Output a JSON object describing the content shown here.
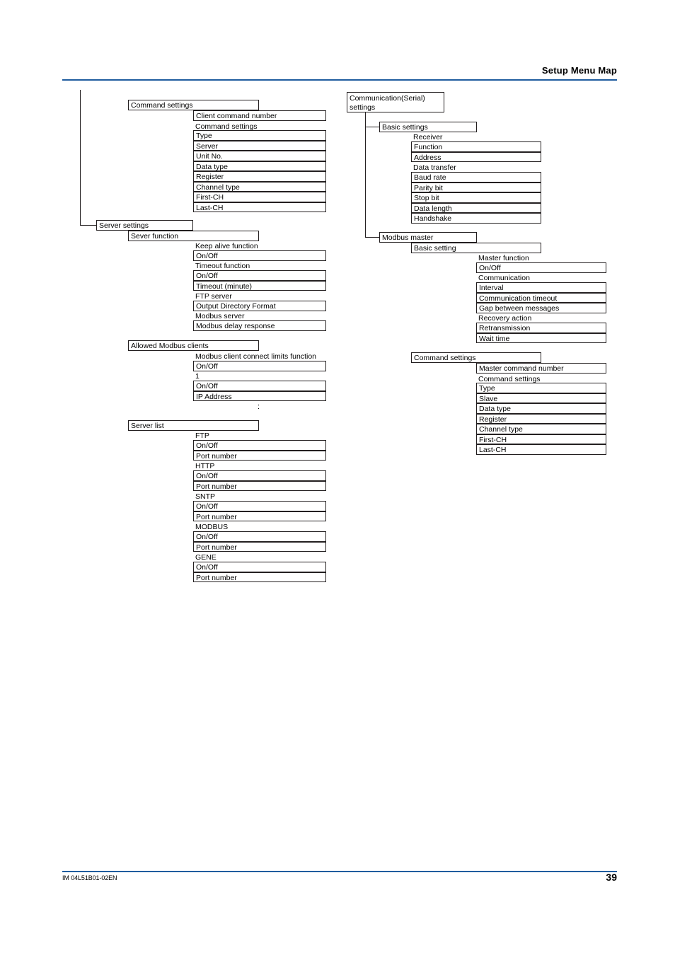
{
  "header": {
    "title": "Setup Menu Map",
    "rule_color": "#1f5c9e"
  },
  "footer": {
    "manual_code": "IM 04L51B01-02EN",
    "page_number": "39"
  },
  "left_column": {
    "groups": [
      {
        "name": "command-settings-client",
        "parent": "Command settings",
        "items": [
          {
            "text": "Client command number",
            "boxed": true
          },
          {
            "text": "Command settings",
            "boxed": false
          },
          {
            "text": "Type",
            "boxed": true
          },
          {
            "text": "Server",
            "boxed": true
          },
          {
            "text": "Unit No.",
            "boxed": true
          },
          {
            "text": "Data type",
            "boxed": true
          },
          {
            "text": "Register",
            "boxed": true
          },
          {
            "text": "Channel type",
            "boxed": true
          },
          {
            "text": "First-CH",
            "boxed": true
          },
          {
            "text": "Last-CH",
            "boxed": true
          }
        ]
      },
      {
        "name": "server-settings",
        "parent": "Server settings",
        "child": "Sever function",
        "items": [
          {
            "text": "Keep alive function",
            "boxed": false
          },
          {
            "text": "On/Off",
            "boxed": true
          },
          {
            "text": "Timeout function",
            "boxed": false
          },
          {
            "text": "On/Off",
            "boxed": true
          },
          {
            "text": "Timeout (minute)",
            "boxed": true
          },
          {
            "text": "FTP server",
            "boxed": false
          },
          {
            "text": "Output Directory Format",
            "boxed": true
          },
          {
            "text": "Modbus server",
            "boxed": false
          },
          {
            "text": "Modbus delay response",
            "boxed": true
          }
        ]
      },
      {
        "name": "allowed-modbus-clients",
        "parent": "Allowed Modbus clients",
        "items": [
          {
            "text": "Modbus client connect limits function",
            "boxed": false
          },
          {
            "text": "On/Off",
            "boxed": true
          },
          {
            "text": "1",
            "boxed": false
          },
          {
            "text": "On/Off",
            "boxed": true
          },
          {
            "text": "IP Address",
            "boxed": true
          }
        ],
        "continuation": ":"
      },
      {
        "name": "server-list",
        "parent": "Server list",
        "items": [
          {
            "text": "FTP",
            "boxed": false
          },
          {
            "text": "On/Off",
            "boxed": true
          },
          {
            "text": "Port number",
            "boxed": true
          },
          {
            "text": "HTTP",
            "boxed": false
          },
          {
            "text": "On/Off",
            "boxed": true
          },
          {
            "text": "Port number",
            "boxed": true
          },
          {
            "text": "SNTP",
            "boxed": false
          },
          {
            "text": "On/Off",
            "boxed": true
          },
          {
            "text": "Port number",
            "boxed": true
          },
          {
            "text": "MODBUS",
            "boxed": false
          },
          {
            "text": "On/Off",
            "boxed": true
          },
          {
            "text": "Port number",
            "boxed": true
          },
          {
            "text": "GENE",
            "boxed": false
          },
          {
            "text": "On/Off",
            "boxed": true
          },
          {
            "text": "Port number",
            "boxed": true
          }
        ]
      }
    ]
  },
  "right_column": {
    "root": "Communication(Serial)\nsettings",
    "root_line1": "Communication(Serial)",
    "root_line2": "settings",
    "groups": [
      {
        "name": "basic-settings",
        "parent": "Basic settings",
        "items": [
          {
            "text": "Receiver",
            "boxed": false
          },
          {
            "text": "Function",
            "boxed": true
          },
          {
            "text": "Address",
            "boxed": true
          },
          {
            "text": "Data transfer",
            "boxed": false
          },
          {
            "text": "Baud rate",
            "boxed": true
          },
          {
            "text": "Parity bit",
            "boxed": true
          },
          {
            "text": "Stop bit",
            "boxed": true
          },
          {
            "text": "Data length",
            "boxed": true
          },
          {
            "text": "Handshake",
            "boxed": true
          }
        ]
      },
      {
        "name": "modbus-master",
        "parent": "Modbus master",
        "child": "Basic setting",
        "items": [
          {
            "text": "Master function",
            "boxed": false
          },
          {
            "text": "On/Off",
            "boxed": true
          },
          {
            "text": "Communication",
            "boxed": false
          },
          {
            "text": "Interval",
            "boxed": true
          },
          {
            "text": "Communication timeout",
            "boxed": true
          },
          {
            "text": "Gap between messages",
            "boxed": true
          },
          {
            "text": "Recovery action",
            "boxed": false
          },
          {
            "text": "Retransmission",
            "boxed": true
          },
          {
            "text": "Wait time",
            "boxed": true
          }
        ]
      },
      {
        "name": "command-settings-master",
        "parent": "Command settings",
        "items": [
          {
            "text": "Master command number",
            "boxed": true
          },
          {
            "text": "Command settings",
            "boxed": false
          },
          {
            "text": "Type",
            "boxed": true
          },
          {
            "text": "Slave",
            "boxed": true
          },
          {
            "text": "Data type",
            "boxed": true
          },
          {
            "text": "Register",
            "boxed": true
          },
          {
            "text": "Channel type",
            "boxed": true
          },
          {
            "text": "First-CH",
            "boxed": true
          },
          {
            "text": "Last-CH",
            "boxed": true
          }
        ]
      }
    ]
  }
}
